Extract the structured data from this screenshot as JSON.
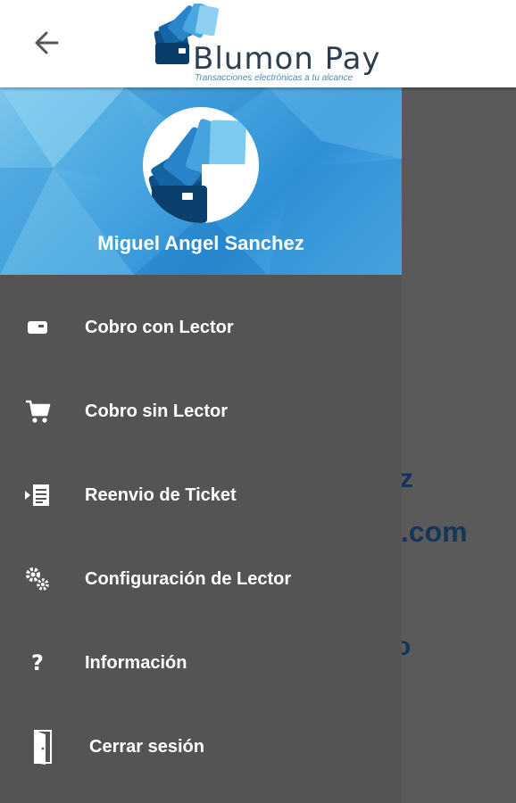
{
  "header": {
    "brand_name": "Blumon Pay",
    "tagline": "Transacciones electrónicas a tu alcance"
  },
  "drawer": {
    "user_name": "Miguel Angel Sanchez",
    "items": [
      {
        "label": "Cobro con Lector",
        "icon": "card-reader-icon"
      },
      {
        "label": "Cobro sin Lector",
        "icon": "cart-icon"
      },
      {
        "label": "Reenvio de Ticket",
        "icon": "ticket-forward-icon"
      },
      {
        "label": "Configuración de Lector",
        "icon": "gears-icon"
      },
      {
        "label": "Información",
        "icon": "question-icon"
      },
      {
        "label": "Cerrar sesión",
        "icon": "door-exit-icon"
      }
    ]
  },
  "background": {
    "text_1": "z",
    "text_2": "l.com",
    "text_3": "o"
  },
  "colors": {
    "header_bg": "#ffffff",
    "drawer_bg": "#545454",
    "overlay_bg": "#5a5a5a",
    "accent": "#2e90d6"
  }
}
